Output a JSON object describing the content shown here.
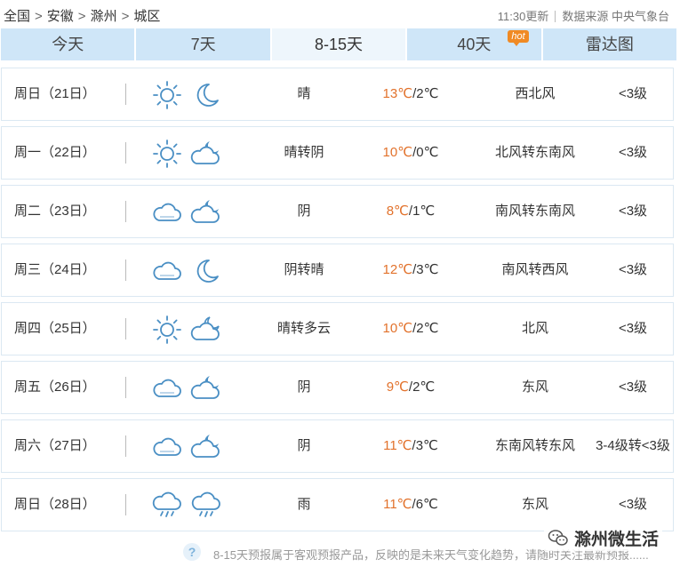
{
  "breadcrumb": {
    "items": [
      "全国",
      "安徽",
      "滁州",
      "城区"
    ],
    "separator": ">"
  },
  "update": {
    "time": "11:30更新",
    "source": "数据来源 中央气象台"
  },
  "tabs": [
    {
      "label": "今天",
      "active": false,
      "hot": ""
    },
    {
      "label": "7天",
      "active": false,
      "hot": ""
    },
    {
      "label": "8-15天",
      "active": true,
      "hot": ""
    },
    {
      "label": "40天",
      "active": false,
      "hot": "hot"
    },
    {
      "label": "雷达图",
      "active": false,
      "hot": ""
    }
  ],
  "forecast": [
    {
      "day": "周日（21日）",
      "icons": [
        "sun-icon",
        "moon-icon"
      ],
      "desc": "晴",
      "hi": "13℃",
      "lo": "/2℃",
      "wind": "西北风",
      "level": "<3级"
    },
    {
      "day": "周一（22日）",
      "icons": [
        "sun-icon",
        "cloudy-night-icon"
      ],
      "desc": "晴转阴",
      "hi": "10℃",
      "lo": "/0℃",
      "wind": "北风转东南风",
      "level": "<3级"
    },
    {
      "day": "周二（23日）",
      "icons": [
        "cloud-icon",
        "cloudy-night-icon"
      ],
      "desc": "阴",
      "hi": "8℃",
      "lo": "/1℃",
      "wind": "南风转东南风",
      "level": "<3级"
    },
    {
      "day": "周三（24日）",
      "icons": [
        "cloud-icon",
        "moon-icon"
      ],
      "desc": "阴转晴",
      "hi": "12℃",
      "lo": "/3℃",
      "wind": "南风转西风",
      "level": "<3级"
    },
    {
      "day": "周四（25日）",
      "icons": [
        "sun-icon",
        "partly-cloudy-night-icon"
      ],
      "desc": "晴转多云",
      "hi": "10℃",
      "lo": "/2℃",
      "wind": "北风",
      "level": "<3级"
    },
    {
      "day": "周五（26日）",
      "icons": [
        "cloud-icon",
        "cloudy-night-icon"
      ],
      "desc": "阴",
      "hi": "9℃",
      "lo": "/2℃",
      "wind": "东风",
      "level": "<3级"
    },
    {
      "day": "周六（27日）",
      "icons": [
        "cloud-icon",
        "cloudy-night-icon"
      ],
      "desc": "阴",
      "hi": "11℃",
      "lo": "/3℃",
      "wind": "东南风转东风",
      "level": "3-4级转<3级"
    },
    {
      "day": "周日（28日）",
      "icons": [
        "rain-icon",
        "rain-icon"
      ],
      "desc": "雨",
      "hi": "11℃",
      "lo": "/6℃",
      "wind": "东风",
      "level": "<3级"
    }
  ],
  "footer": {
    "help": "?",
    "note": "8-15天预报属于客观预报产品，反映的是未来天气变化趋势，请随时关注最新预报......",
    "watermark": "滁州微生活"
  },
  "colors": {
    "tab_bg": "#cfe6f8",
    "tab_active_bg": "#eef6fc",
    "icon_stroke": "#4a8fc4",
    "temp_high": "#e2722c",
    "row_border": "#dbe8f2",
    "hot_badge": "#f08a24"
  }
}
